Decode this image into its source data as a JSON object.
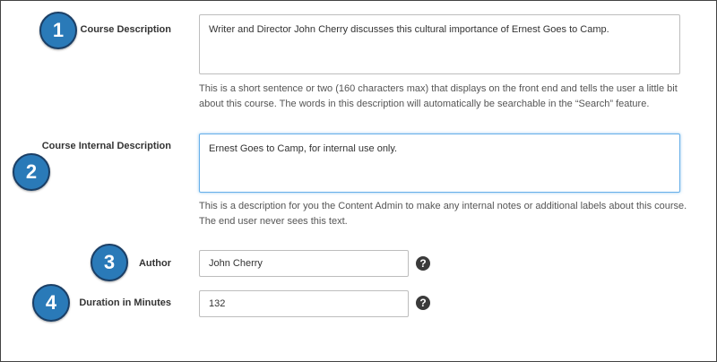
{
  "badges": {
    "b1": "1",
    "b2": "2",
    "b3": "3",
    "b4": "4"
  },
  "course_description": {
    "label": "Course Description",
    "value": "Writer and Director John Cherry discusses this cultural importance of Ernest Goes to Camp.",
    "help_line1": "This is a short sentence or two (160 characters max) that displays on the front end and tells the user a little bit",
    "help_line2": "about this course. The words in this description will automatically be searchable in the “Search” feature."
  },
  "internal_description": {
    "label": "Course Internal Description",
    "value": "Ernest Goes to Camp, for internal use only.",
    "help_line1": "This is a description for you the Content Admin to make any internal notes or additional labels about this course.",
    "help_line2": "The end user never sees this text."
  },
  "author": {
    "label": "Author",
    "value": "John Cherry",
    "help_icon": "?"
  },
  "duration": {
    "label": "Duration in Minutes",
    "value": "132",
    "help_icon": "?"
  },
  "colors": {
    "badge": "#2a7ab8",
    "focus_border": "#66afe9"
  }
}
